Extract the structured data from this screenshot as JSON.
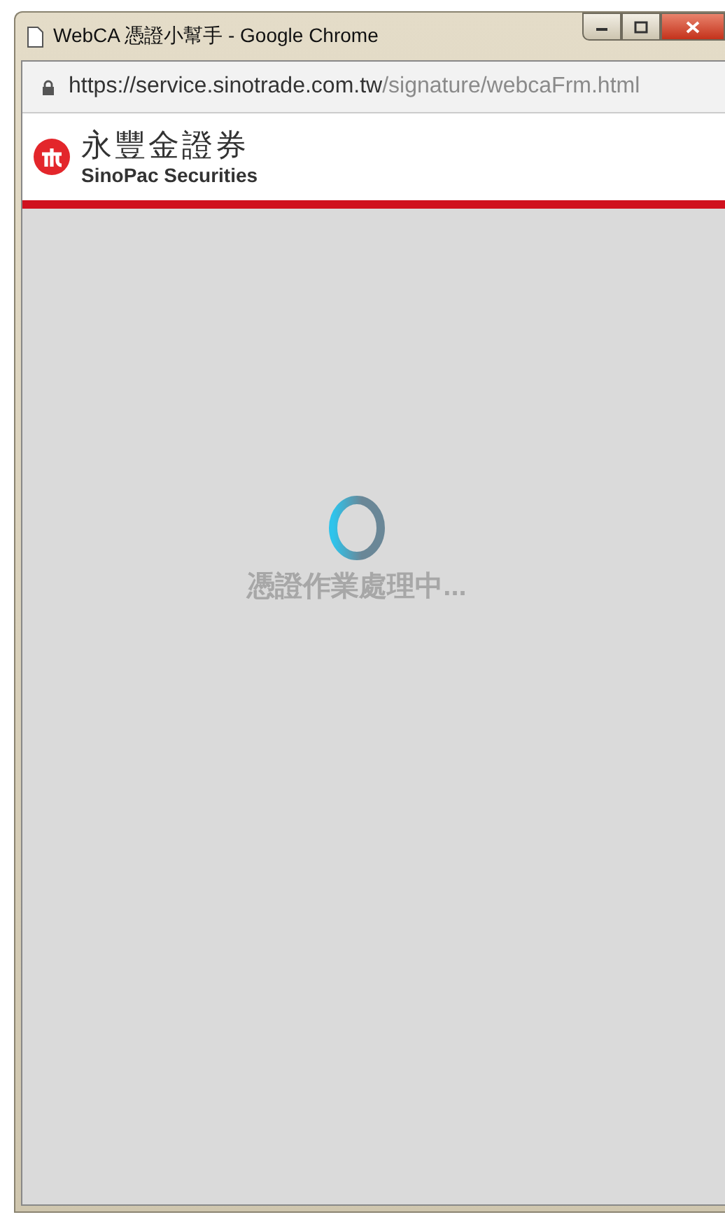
{
  "window": {
    "title": "WebCA 憑證小幫手 - Google Chrome"
  },
  "address_bar": {
    "secure": true,
    "url_origin": "https://service.sinotrade.com.tw",
    "url_path": "/signature/webcaFrm.html"
  },
  "brand": {
    "name": "永豐金證券",
    "subtitle": "SinoPac Securities"
  },
  "loading": {
    "message": "憑證作業處理中..."
  }
}
